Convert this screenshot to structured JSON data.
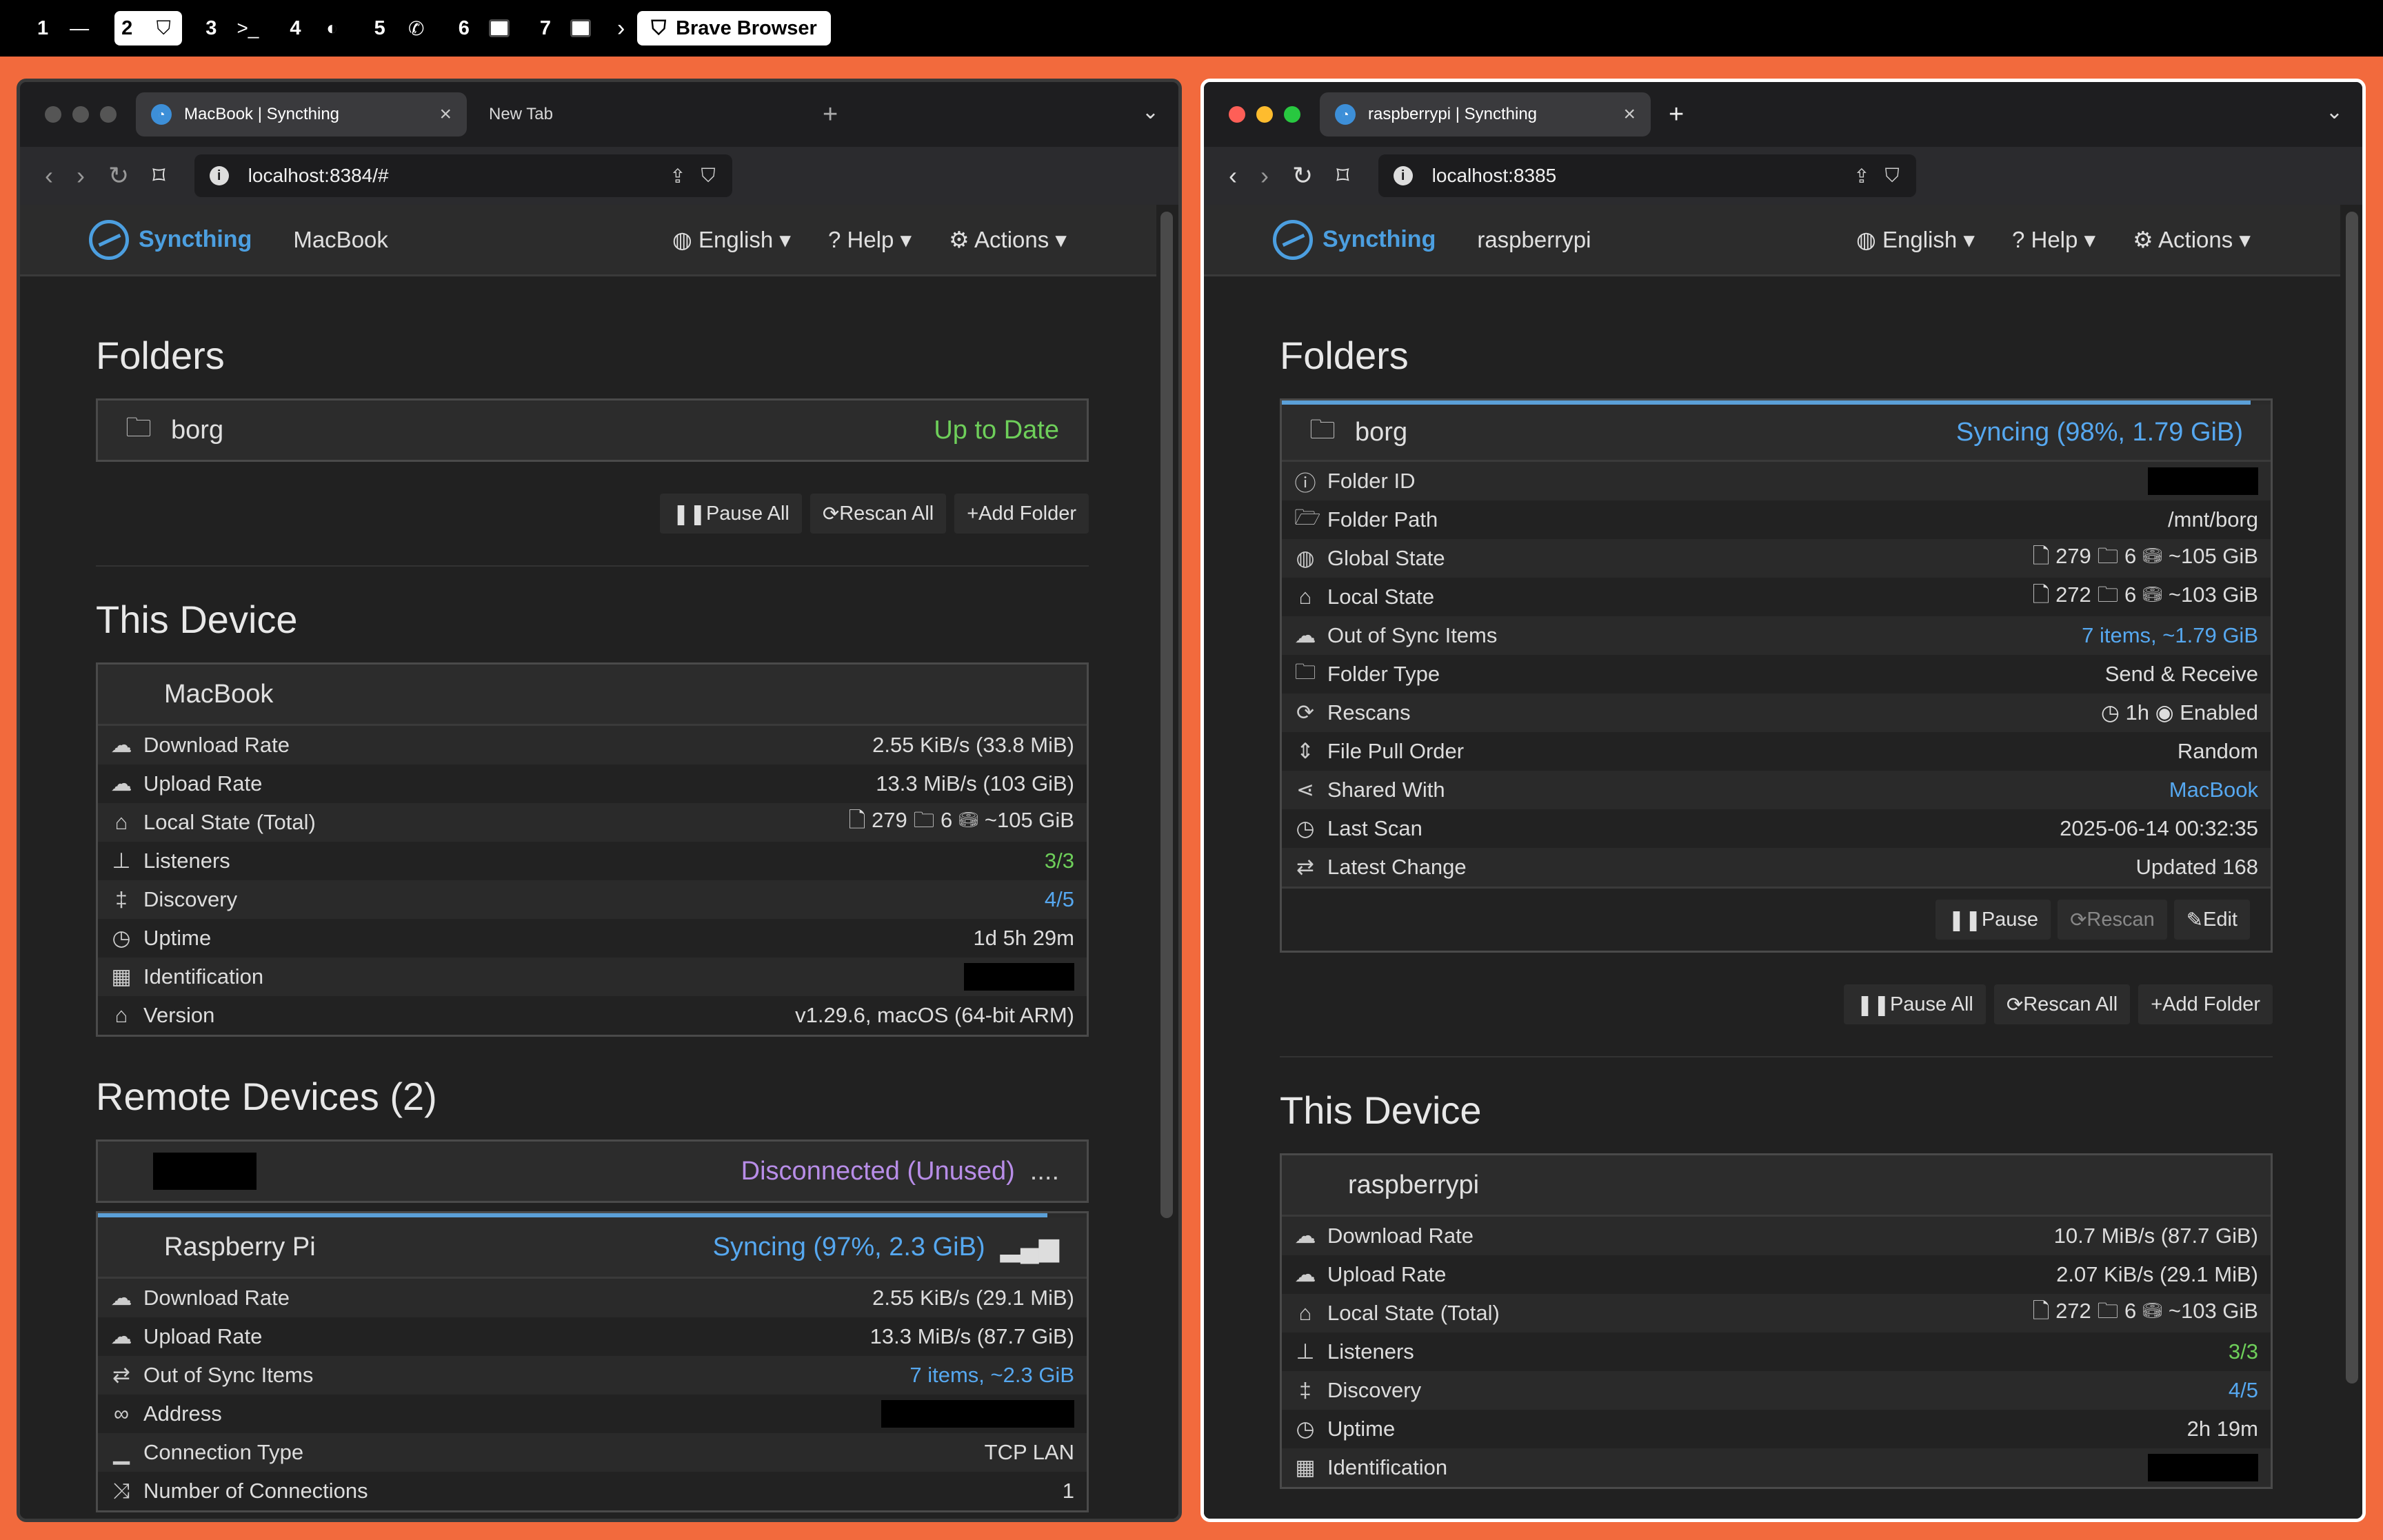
{
  "topbar": {
    "workspaces": [
      {
        "num": "1",
        "icon": "dash-icon",
        "glyph": "—"
      },
      {
        "num": "2",
        "icon": "brave-icon",
        "glyph": "⛉"
      },
      {
        "num": "3",
        "icon": "terminal-icon",
        "glyph": ">_"
      },
      {
        "num": "4",
        "icon": "mouse-icon",
        "glyph": "◐"
      },
      {
        "num": "5",
        "icon": "whatsapp-icon",
        "glyph": "✆"
      },
      {
        "num": "6",
        "icon": "window-icon",
        "glyph": ""
      },
      {
        "num": "7",
        "icon": "window-icon",
        "glyph": ""
      }
    ],
    "app": "Brave Browser"
  },
  "left": {
    "tab_title": "MacBook | Syncthing",
    "tab2_title": "New Tab",
    "url": "localhost:8384/#",
    "brand": "Syncthing",
    "device": "MacBook",
    "menus": [
      "English",
      "Help",
      "Actions"
    ],
    "folders_heading": "Folders",
    "folder": {
      "name": "borg",
      "status": "Up to Date"
    },
    "buttons": [
      "Pause All",
      "Rescan All",
      "Add Folder"
    ],
    "this_device_heading": "This Device",
    "this_device": {
      "name": "MacBook",
      "rows": [
        {
          "icon": "cloud-down-icon",
          "glyph": "☁",
          "label": "Download Rate",
          "value": "2.55 KiB/s (33.8 MiB)"
        },
        {
          "icon": "cloud-up-icon",
          "glyph": "☁",
          "label": "Upload Rate",
          "value": "13.3 MiB/s (103 GiB)"
        },
        {
          "icon": "home-icon",
          "glyph": "⌂",
          "label": "Local State (Total)",
          "value": "🗋 279  🗀 6  ⛁ ~105 GiB"
        },
        {
          "icon": "sitemap-icon",
          "glyph": "⊥",
          "label": "Listeners",
          "value": "3/3",
          "cls": "green"
        },
        {
          "icon": "signpost-icon",
          "glyph": "‡",
          "label": "Discovery",
          "value": "4/5",
          "cls": "blue"
        },
        {
          "icon": "clock-icon",
          "glyph": "◷",
          "label": "Uptime",
          "value": "1d 5h 29m"
        },
        {
          "icon": "qrcode-icon",
          "glyph": "▦",
          "label": "Identification",
          "value": "",
          "redact": true
        },
        {
          "icon": "tag-icon",
          "glyph": "⌂",
          "label": "Version",
          "value": "v1.29.6, macOS (64-bit ARM)"
        }
      ]
    },
    "remote_heading": "Remote Devices (2)",
    "remote1_status": "Disconnected (Unused)",
    "remote2": {
      "name": "Raspberry Pi",
      "status": "Syncing (97%, 2.3 GiB)",
      "rows": [
        {
          "icon": "cloud-down-icon",
          "glyph": "☁",
          "label": "Download Rate",
          "value": "2.55 KiB/s (29.1 MiB)"
        },
        {
          "icon": "cloud-up-icon",
          "glyph": "☁",
          "label": "Upload Rate",
          "value": "13.3 MiB/s (87.7 GiB)"
        },
        {
          "icon": "exchange-icon",
          "glyph": "⇄",
          "label": "Out of Sync Items",
          "value": "7 items, ~2.3 GiB",
          "cls": "blue"
        },
        {
          "icon": "link-icon",
          "glyph": "∞",
          "label": "Address",
          "value": "",
          "redact": true
        },
        {
          "icon": "signal-icon",
          "glyph": "▁",
          "label": "Connection Type",
          "value": "TCP LAN"
        },
        {
          "icon": "random-icon",
          "glyph": "⤨",
          "label": "Number of Connections",
          "value": "1"
        }
      ]
    }
  },
  "right": {
    "tab_title": "raspberrypi | Syncthing",
    "url": "localhost:8385",
    "brand": "Syncthing",
    "device": "raspberrypi",
    "menus": [
      "English",
      "Help",
      "Actions"
    ],
    "folders_heading": "Folders",
    "folder": {
      "name": "borg",
      "status": "Syncing (98%, 1.79 GiB)",
      "rows": [
        {
          "icon": "info-icon",
          "glyph": "ⓘ",
          "label": "Folder ID",
          "value": "",
          "redact": true
        },
        {
          "icon": "folder-open-icon",
          "glyph": "🗁",
          "label": "Folder Path",
          "value": "/mnt/borg"
        },
        {
          "icon": "globe-icon",
          "glyph": "◍",
          "label": "Global State",
          "value": "🗋 279  🗀 6  ⛁ ~105 GiB"
        },
        {
          "icon": "home-icon",
          "glyph": "⌂",
          "label": "Local State",
          "value": "🗋 272  🗀 6  ⛁ ~103 GiB"
        },
        {
          "icon": "cloud-down-icon",
          "glyph": "☁",
          "label": "Out of Sync Items",
          "value": "7 items, ~1.79 GiB",
          "cls": "blue"
        },
        {
          "icon": "folder-icon",
          "glyph": "🗀",
          "label": "Folder Type",
          "value": "Send & Receive"
        },
        {
          "icon": "refresh-icon",
          "glyph": "⟳",
          "label": "Rescans",
          "value": "◷ 1h   ◉ Enabled"
        },
        {
          "icon": "sort-icon",
          "glyph": "⇕",
          "label": "File Pull Order",
          "value": "Random"
        },
        {
          "icon": "share-icon",
          "glyph": "⋖",
          "label": "Shared With",
          "value": "MacBook",
          "cls": "blue"
        },
        {
          "icon": "clock-icon",
          "glyph": "◷",
          "label": "Last Scan",
          "value": "2025-06-14 00:32:35"
        },
        {
          "icon": "exchange-icon",
          "glyph": "⇄",
          "label": "Latest Change",
          "value": "Updated 168"
        }
      ],
      "buttons": [
        "Pause",
        "Rescan",
        "Edit"
      ]
    },
    "buttons": [
      "Pause All",
      "Rescan All",
      "Add Folder"
    ],
    "this_device_heading": "This Device",
    "this_device": {
      "name": "raspberrypi",
      "rows": [
        {
          "icon": "cloud-down-icon",
          "glyph": "☁",
          "label": "Download Rate",
          "value": "10.7 MiB/s (87.7 GiB)"
        },
        {
          "icon": "cloud-up-icon",
          "glyph": "☁",
          "label": "Upload Rate",
          "value": "2.07 KiB/s (29.1 MiB)"
        },
        {
          "icon": "home-icon",
          "glyph": "⌂",
          "label": "Local State (Total)",
          "value": "🗋 272  🗀 6  ⛁ ~103 GiB"
        },
        {
          "icon": "sitemap-icon",
          "glyph": "⊥",
          "label": "Listeners",
          "value": "3/3",
          "cls": "green"
        },
        {
          "icon": "signpost-icon",
          "glyph": "‡",
          "label": "Discovery",
          "value": "4/5",
          "cls": "blue"
        },
        {
          "icon": "clock-icon",
          "glyph": "◷",
          "label": "Uptime",
          "value": "2h 19m"
        },
        {
          "icon": "qrcode-icon",
          "glyph": "▦",
          "label": "Identification",
          "value": "",
          "redact": true
        }
      ]
    }
  },
  "colors": {
    "wallpaper": "#f26a3d",
    "accent": "#56a8f0",
    "green": "#6ecf5a",
    "purple": "#b88de8"
  }
}
